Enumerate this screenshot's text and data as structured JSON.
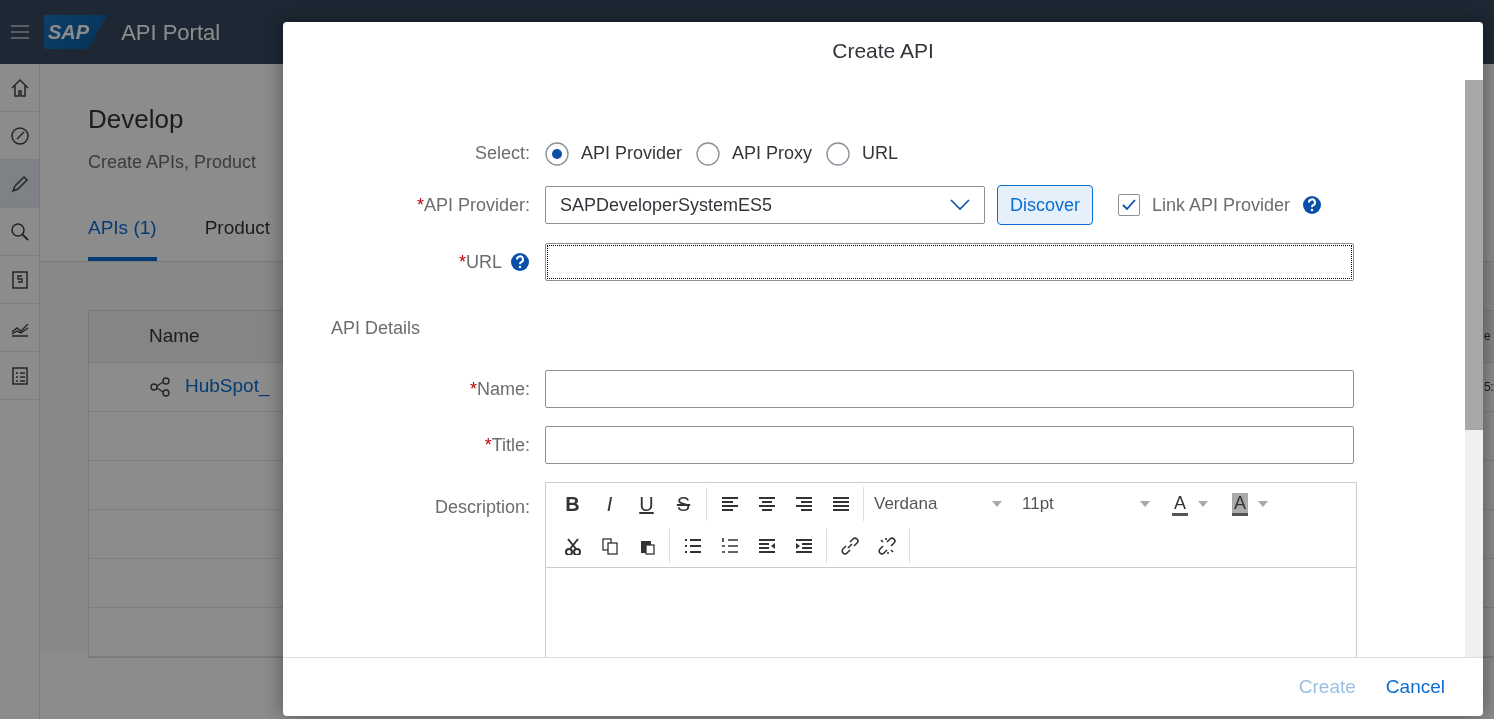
{
  "shell": {
    "logo": "SAP",
    "title": "API Portal"
  },
  "sidebar": {
    "items": [
      {
        "kind": "home",
        "selected": false
      },
      {
        "kind": "gauge",
        "selected": false
      },
      {
        "kind": "pencil",
        "selected": true
      },
      {
        "kind": "magnifier",
        "selected": false
      },
      {
        "kind": "dollar",
        "selected": false
      },
      {
        "kind": "chart",
        "selected": false
      },
      {
        "kind": "list",
        "selected": false
      }
    ]
  },
  "page": {
    "title": "Develop",
    "subtitle": "Create APIs, Product",
    "tabs": [
      {
        "label": "APIs (1)",
        "selected": true
      },
      {
        "label": "Product",
        "selected": false
      }
    ],
    "table": {
      "columns": [
        "Name",
        "e"
      ],
      "rows": [
        {
          "cells": [
            "HubSpot_",
            "5:"
          ]
        }
      ]
    }
  },
  "dialog": {
    "title": "Create API",
    "required_mark": "*",
    "select": {
      "label": "Select:",
      "options": [
        {
          "label": "API Provider",
          "selected": true
        },
        {
          "label": "API Proxy",
          "selected": false
        },
        {
          "label": "URL",
          "selected": false
        }
      ]
    },
    "provider": {
      "label": "API Provider:",
      "required": true,
      "value": "SAPDeveloperSystemES5",
      "button": "Discover",
      "link": {
        "label": "Link API Provider",
        "checked": true,
        "help": true
      }
    },
    "url": {
      "label": "URL",
      "required": true,
      "help": true,
      "focused": true
    },
    "section": "API Details",
    "details": [
      {
        "label": "Name:",
        "required": true
      },
      {
        "label": "Title:",
        "required": true
      }
    ],
    "description": {
      "label": "Description:",
      "format_buttons": [
        "B",
        "I",
        "U",
        "S"
      ],
      "font": "Verdana",
      "size": "11pt",
      "color_buttons": [
        "A",
        "A"
      ]
    },
    "buttons": [
      {
        "label": "Create",
        "disabled": true
      },
      {
        "label": "Cancel",
        "disabled": false
      }
    ]
  }
}
